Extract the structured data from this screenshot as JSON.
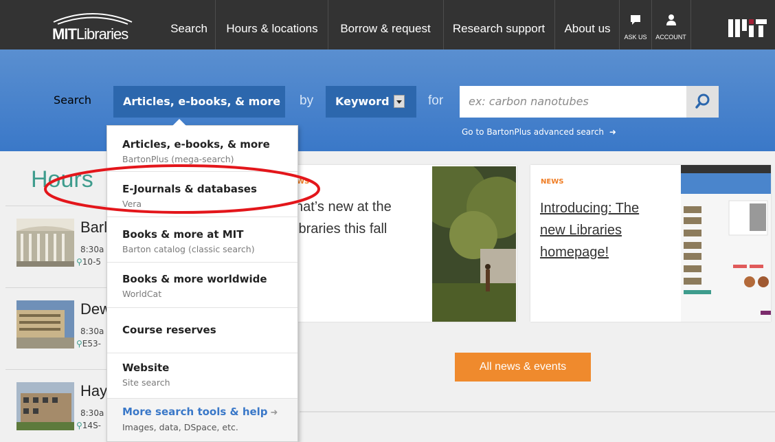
{
  "nav": {
    "logo_bold": "MIT",
    "logo_rest": "Libraries",
    "items": [
      {
        "label": "Search"
      },
      {
        "label": "Hours & locations"
      },
      {
        "label": "Borrow & request"
      },
      {
        "label": "Research support"
      },
      {
        "label": "About us"
      }
    ],
    "ask_us": "ASK US",
    "account": "ACCOUNT"
  },
  "search": {
    "label_search": "Search",
    "scope_selected": "Articles, e-books, & more",
    "label_by": "by",
    "type_selected": "Keyword",
    "label_for": "for",
    "placeholder": "ex: carbon nanotubes",
    "advanced_link": "Go to BartonPlus advanced search"
  },
  "dropdown": {
    "items": [
      {
        "title": "Articles, e-books, & more",
        "subtitle": "BartonPlus (mega-search)"
      },
      {
        "title": "E-Journals & databases",
        "subtitle": "Vera"
      },
      {
        "title": "Books & more at MIT",
        "subtitle": "Barton catalog (classic search)"
      },
      {
        "title": "Books & more worldwide",
        "subtitle": "WorldCat"
      },
      {
        "title": "Course reserves",
        "subtitle": ""
      },
      {
        "title": "Website",
        "subtitle": "Site search"
      },
      {
        "title": "More search tools & help",
        "subtitle": "Images, data, DSpace, etc."
      }
    ]
  },
  "hours": {
    "title": "Hours",
    "locations": [
      {
        "name": "Barl",
        "time": "8:30a",
        "room": "10-5"
      },
      {
        "name": "Dew",
        "time": "8:30a",
        "room": "E53-"
      },
      {
        "name": "Hay",
        "time": "8:30a",
        "room": "14S-"
      }
    ]
  },
  "news": [
    {
      "label": "WS",
      "title_line1": "hat’s new at the",
      "title_line2": "ibraries this fall"
    },
    {
      "label": "NEWS",
      "title_line1": "Introducing: The",
      "title_line2": "new Libraries",
      "title_line3": "homepage!"
    }
  ],
  "all_news_button": "All news & events",
  "colors": {
    "nav_bg": "#333333",
    "search_band": "#3a78c8",
    "accent_orange": "#ef8a2d",
    "hours_teal": "#3e9c8d",
    "annotation_red": "#e3161b"
  }
}
